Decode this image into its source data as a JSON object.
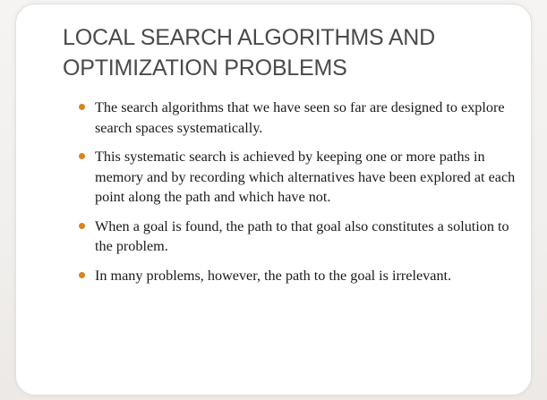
{
  "slide": {
    "title_line1": "LOCAL SEARCH ALGORITHMS AND",
    "title_line2": "OPTIMIZATION PROBLEMS",
    "bullets": [
      "The search algorithms that we have seen so far are designed to explore search spaces systematically.",
      "This systematic search is achieved by keeping one or more paths in memory and by recording which alternatives have been explored at each point along the path and which have not.",
      "When a goal is found, the path to that goal also constitutes a solution to the problem.",
      "In many problems, however, the path to the goal is irrelevant."
    ],
    "bullet_icon": "bullet-dot-icon",
    "colors": {
      "bullet": "#d9841f",
      "title": "#4a4a4a",
      "body": "#1a1a1a"
    }
  }
}
